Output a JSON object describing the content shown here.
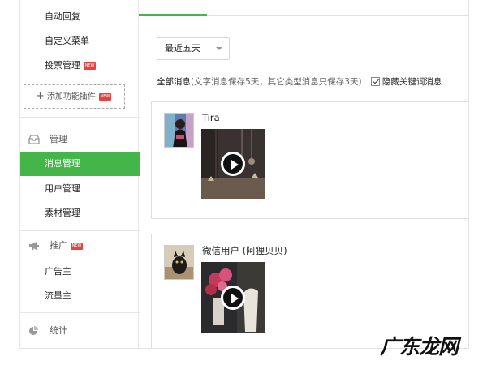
{
  "sidebar": {
    "items_top": [
      {
        "label": "自动回复"
      },
      {
        "label": "自定义菜单"
      },
      {
        "label": "投票管理",
        "badge": "NEW"
      }
    ],
    "add_plugin": {
      "label": "添加功能插件",
      "badge": "NEW"
    },
    "sections": [
      {
        "title": "管理",
        "icon": "inbox-icon",
        "items": [
          {
            "label": "消息管理",
            "active": true
          },
          {
            "label": "用户管理"
          },
          {
            "label": "素材管理"
          }
        ]
      },
      {
        "title": "推广",
        "icon": "megaphone-icon",
        "badge": "NEW",
        "items": [
          {
            "label": "广告主"
          },
          {
            "label": "流量主"
          }
        ]
      },
      {
        "title": "统计",
        "icon": "pie-chart-icon",
        "items": []
      }
    ],
    "accent_color": "#44b549",
    "badge_color": "#e64340"
  },
  "main": {
    "date_filter": {
      "selected": "最近五天"
    },
    "filter": {
      "label": "全部消息",
      "note": "(文字消息保存5天，其它类型消息只保存3天)",
      "hide_keyword_label": "隐藏关键词消息",
      "hide_keyword_checked": true
    },
    "messages": [
      {
        "username": "Tira",
        "type": "video"
      },
      {
        "username": "微信用户 (阿狸贝贝)",
        "type": "video"
      }
    ]
  },
  "watermark": "广东龙网"
}
